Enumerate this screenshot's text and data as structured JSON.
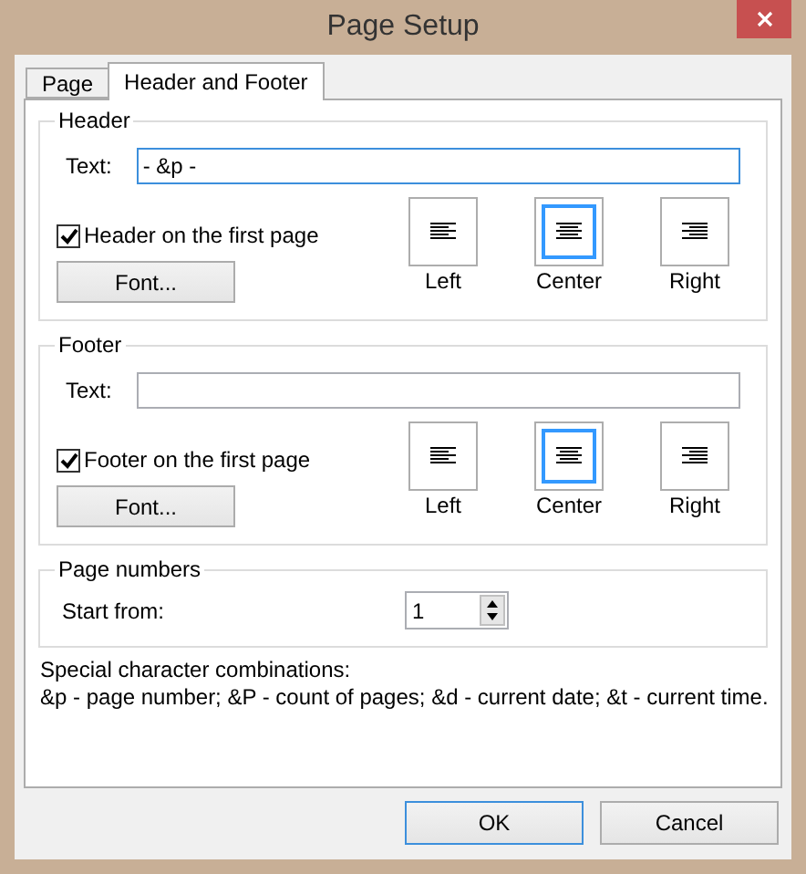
{
  "window": {
    "title": "Page Setup"
  },
  "tabs": [
    {
      "label": "Page",
      "selected": false
    },
    {
      "label": "Header and Footer",
      "selected": true
    }
  ],
  "sections": [
    {
      "title": "Header",
      "text_label": "Text:",
      "text_value": "- &p -",
      "focused": true,
      "first_page": {
        "label": "Header on the first page",
        "checked": true
      },
      "font_button": "Font...",
      "alignments": [
        {
          "kind": "left",
          "label": "Left",
          "selected": false
        },
        {
          "kind": "center",
          "label": "Center",
          "selected": true
        },
        {
          "kind": "right",
          "label": "Right",
          "selected": false
        }
      ]
    },
    {
      "title": "Footer",
      "text_label": "Text:",
      "focused": false,
      "first_page": {
        "label": "Footer on the first page",
        "checked": true
      },
      "font_button": "Font...",
      "alignments": [
        {
          "kind": "left",
          "label": "Left",
          "selected": false
        },
        {
          "kind": "center",
          "label": "Center",
          "selected": true
        },
        {
          "kind": "right",
          "label": "Right",
          "selected": false
        }
      ]
    }
  ],
  "page_numbers": {
    "title": "Page numbers",
    "start_label": "Start from:",
    "value": "1"
  },
  "special_lines": [
    "Special character combinations:",
    "&p - page number; &P - count of pages; &d - current date; &t - current time."
  ],
  "buttons": [
    {
      "label": "OK",
      "default": true
    },
    {
      "label": "Cancel",
      "default": false
    }
  ]
}
